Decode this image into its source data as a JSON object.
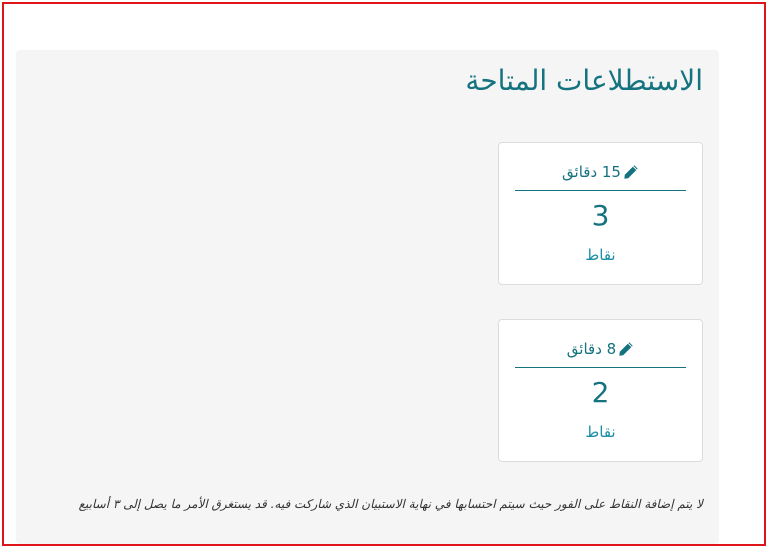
{
  "panel": {
    "title": "الاستطلاعات المتاحة"
  },
  "cards": [
    {
      "duration": "15 دقائق",
      "points": "3",
      "unit": "نقاط",
      "icon": "pencil-icon"
    },
    {
      "duration": "8 دقائق",
      "points": "2",
      "unit": "نقاط",
      "icon": "pencil-icon"
    }
  ],
  "note": "لا يتم إضافة النقاط على الفور حيث سيتم احتسابها في نهاية الاستبيان الذي شاركت فيه. قد يستغرق الأمر ما يصل إلى ٣ أسابيع",
  "colors": {
    "frame_border": "#e0141b",
    "accent": "#15727f",
    "panel_bg": "#f5f5f5"
  }
}
